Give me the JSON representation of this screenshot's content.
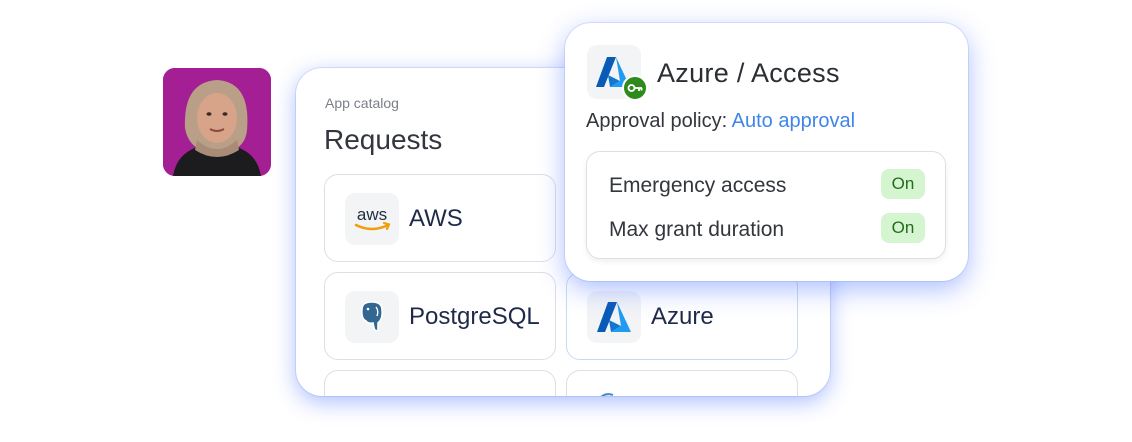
{
  "catalog": {
    "eyebrow": "App catalog",
    "title": "Requests",
    "apps": [
      {
        "name": "AWS",
        "logo_text": "aws"
      },
      {
        "name": "PostgreSQL"
      },
      {
        "name": "Azure"
      }
    ]
  },
  "detail": {
    "title": "Azure / Access",
    "policy_label": "Approval policy:",
    "policy_value": "Auto approval",
    "settings": [
      {
        "label": "Emergency access",
        "value": "On"
      },
      {
        "label": "Max grant duration",
        "value": "On"
      }
    ]
  },
  "colors": {
    "avatar_bg": "#a51f94",
    "accent_link": "#3f86e8",
    "badge_green": "#2f8a1c",
    "pill_bg": "#d5f5d0",
    "glow": "#466eff"
  }
}
